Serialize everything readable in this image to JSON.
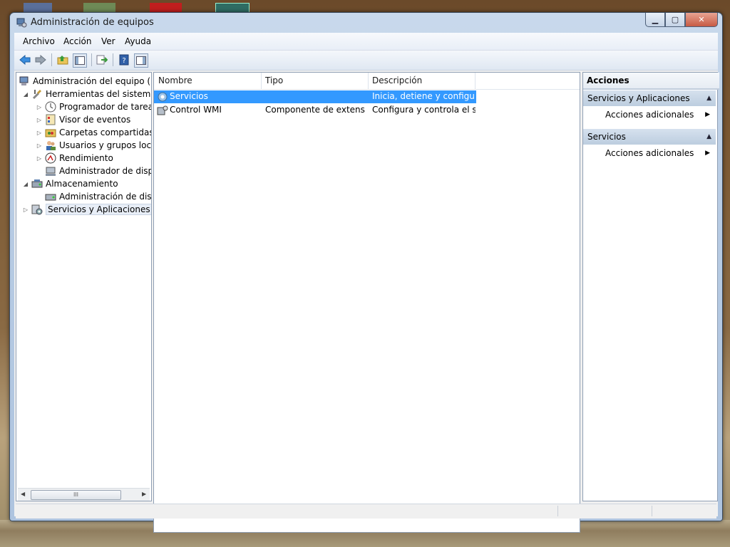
{
  "window": {
    "title": "Administración de equipos",
    "buttons": {
      "minimize": "▁",
      "maximize": "▢",
      "close": "✕"
    }
  },
  "menu": [
    "Archivo",
    "Acción",
    "Ver",
    "Ayuda"
  ],
  "toolbar": {
    "icons": [
      "back-arrow-icon",
      "forward-arrow-icon",
      "up-folder-icon",
      "show-hide-tree-icon",
      "export-list-icon",
      "help-icon",
      "show-hide-action-pane-icon"
    ]
  },
  "tree": {
    "items": [
      {
        "label": "Administración del equipo (loc",
        "level": 0,
        "expander": "",
        "icon": "computer-icon"
      },
      {
        "label": "Herramientas del sistema",
        "level": 1,
        "expander": "◢",
        "icon": "tools-icon"
      },
      {
        "label": "Programador de tareas",
        "level": 2,
        "expander": "▷",
        "icon": "clock-icon"
      },
      {
        "label": "Visor de eventos",
        "level": 2,
        "expander": "▷",
        "icon": "event-viewer-icon"
      },
      {
        "label": "Carpetas compartidas",
        "level": 2,
        "expander": "▷",
        "icon": "shared-folder-icon"
      },
      {
        "label": "Usuarios y grupos locale",
        "level": 2,
        "expander": "▷",
        "icon": "users-icon"
      },
      {
        "label": "Rendimiento",
        "level": 2,
        "expander": "▷",
        "icon": "performance-icon"
      },
      {
        "label": "Administrador de dispo",
        "level": 2,
        "expander": "",
        "icon": "device-manager-icon"
      },
      {
        "label": "Almacenamiento",
        "level": 1,
        "expander": "◢",
        "icon": "storage-icon"
      },
      {
        "label": "Administración de disco",
        "level": 2,
        "expander": "",
        "icon": "disk-icon"
      },
      {
        "label": "Servicios y Aplicaciones",
        "level": 1,
        "expander": "▷",
        "icon": "services-apps-icon",
        "selected": true
      }
    ],
    "scroll_thumb": "III"
  },
  "list": {
    "columns": [
      "Nombre",
      "Tipo",
      "Descripción"
    ],
    "rows": [
      {
        "name": "Servicios",
        "type": "",
        "description": "Inicia, detiene y configu...",
        "icon": "gear-icon",
        "selected": true
      },
      {
        "name": "Control WMI",
        "type": "Componente de extensi...",
        "description": "Configura y controla el s...",
        "icon": "wmi-icon",
        "selected": false
      }
    ]
  },
  "actions": {
    "title": "Acciones",
    "sections": [
      {
        "header": "Servicios y Aplicaciones",
        "items": [
          "Acciones adicionales"
        ]
      },
      {
        "header": "Servicios",
        "items": [
          "Acciones adicionales"
        ]
      }
    ]
  },
  "colors": {
    "selection": "#3399ff",
    "section_header": "#c9d7e8",
    "title_bar": "#b7cbe3"
  }
}
